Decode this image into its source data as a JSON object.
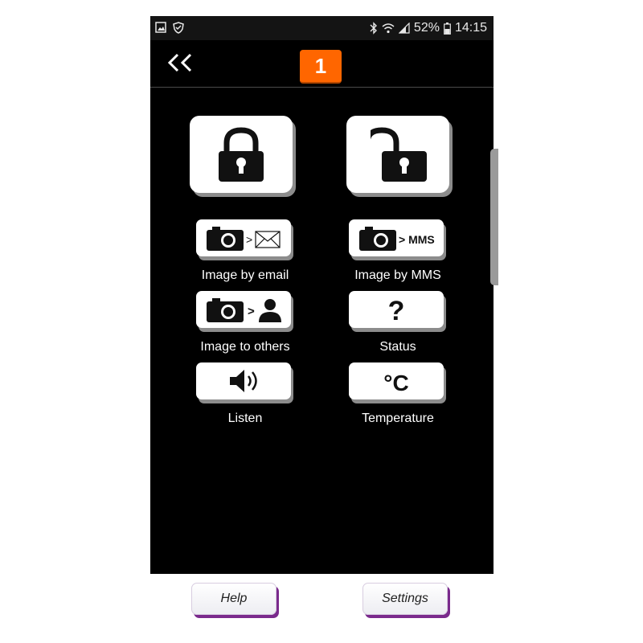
{
  "statusbar": {
    "battery": "52%",
    "time": "14:15"
  },
  "header": {
    "badge": "1",
    "back_icon": "double-chevron-left-icon"
  },
  "actions": {
    "lock": {
      "icon": "lock-closed-icon"
    },
    "unlock": {
      "icon": "lock-open-icon"
    },
    "image_email": {
      "label": "Image by email",
      "arrow": ">"
    },
    "image_mms": {
      "label": "Image by MMS",
      "arrow": "> MMS"
    },
    "image_others": {
      "label": "Image to others",
      "arrow": ">"
    },
    "status": {
      "label": "Status",
      "symbol": "?"
    },
    "listen": {
      "label": "Listen"
    },
    "temperature": {
      "label": "Temperature",
      "symbol": "°C"
    }
  },
  "footer": {
    "help_label": "Help",
    "settings_label": "Settings"
  },
  "colors": {
    "badge": "#ff6600",
    "background": "#000000",
    "button_shadow": "#7a2a8c"
  }
}
